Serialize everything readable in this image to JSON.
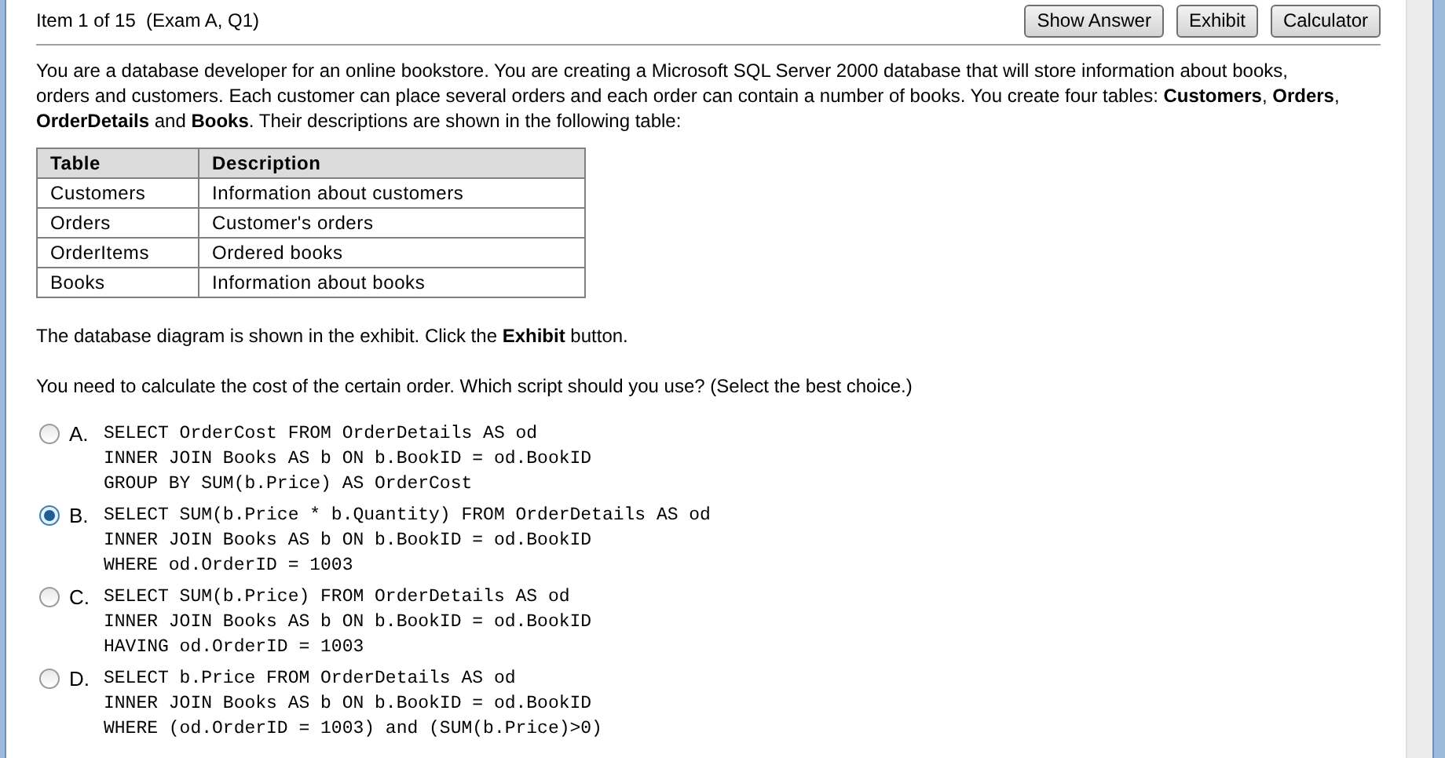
{
  "header": {
    "item": "Item 1 of 15  (Exam A, Q1)",
    "buttons": [
      "Show Answer",
      "Exhibit",
      "Calculator"
    ]
  },
  "question": {
    "intro": "You are a database developer for an online bookstore. You are creating a Microsoft SQL Server 2000 database that will store information about books, orders and customers. Each customer can place several orders and each order can contain a number of books. You create four tables: **Customers**, **Orders**, **OrderDetails** and **Books**. Their descriptions are shown in the following table:",
    "table": {
      "columns": [
        "Table",
        "Description"
      ],
      "rows": [
        [
          "Customers",
          "Information about customers"
        ],
        [
          "Orders",
          "Customer's orders"
        ],
        [
          "OrderItems",
          "Ordered books"
        ],
        [
          "Books",
          "Information about books"
        ]
      ]
    },
    "exhibit_note": "The database diagram is shown in the exhibit. Click the **Exhibit** button.",
    "prompt": "You need to calculate the cost of the certain order. Which script should you use? (Select the best choice.)"
  },
  "options": [
    {
      "letter": "A.",
      "selected": false,
      "lines": [
        "SELECT OrderCost FROM OrderDetails AS od",
        "INNER JOIN Books AS b ON b.BookID = od.BookID",
        "GROUP BY SUM(b.Price) AS OrderCost"
      ]
    },
    {
      "letter": "B.",
      "selected": true,
      "lines": [
        "SELECT SUM(b.Price * b.Quantity) FROM OrderDetails AS od",
        "INNER JOIN Books AS b ON b.BookID = od.BookID",
        "WHERE od.OrderID = 1003"
      ]
    },
    {
      "letter": "C.",
      "selected": false,
      "lines": [
        "SELECT SUM(b.Price) FROM OrderDetails AS od",
        "INNER JOIN Books AS b ON b.BookID = od.BookID",
        "HAVING od.OrderID = 1003"
      ]
    },
    {
      "letter": "D.",
      "selected": false,
      "lines": [
        "SELECT b.Price FROM OrderDetails AS od",
        "INNER JOIN Books AS b ON b.BookID = od.BookID",
        "WHERE (od.OrderID = 1003) and (SUM(b.Price)>0)"
      ]
    }
  ]
}
